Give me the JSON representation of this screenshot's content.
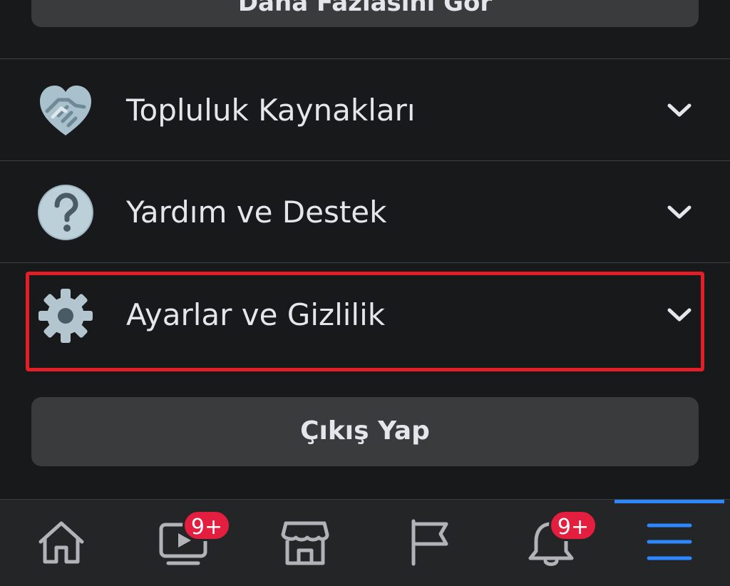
{
  "top_button": {
    "label": "Daha Fazlasını Gör"
  },
  "menu": {
    "items": [
      {
        "label": "Topluluk Kaynakları",
        "icon": "handshake-heart-icon"
      },
      {
        "label": "Yardım ve Destek",
        "icon": "question-circle-icon"
      },
      {
        "label": "Ayarlar ve Gizlilik",
        "icon": "gear-icon",
        "highlighted": true
      }
    ]
  },
  "logout": {
    "label": "Çıkış Yap"
  },
  "tabbar": {
    "tabs": [
      {
        "name": "home",
        "icon": "home-icon"
      },
      {
        "name": "watch",
        "icon": "video-icon",
        "badge": "9+"
      },
      {
        "name": "marketplace",
        "icon": "store-icon"
      },
      {
        "name": "pages",
        "icon": "flag-icon"
      },
      {
        "name": "notifications",
        "icon": "bell-icon",
        "badge": "9+"
      },
      {
        "name": "menu",
        "icon": "hamburger-menu-icon",
        "active": true
      }
    ]
  },
  "colors": {
    "background": "#18191b",
    "surface": "#3a3b3c",
    "highlight_border": "#e41e26",
    "badge": "#e41e3f",
    "active": "#2d88ff"
  }
}
